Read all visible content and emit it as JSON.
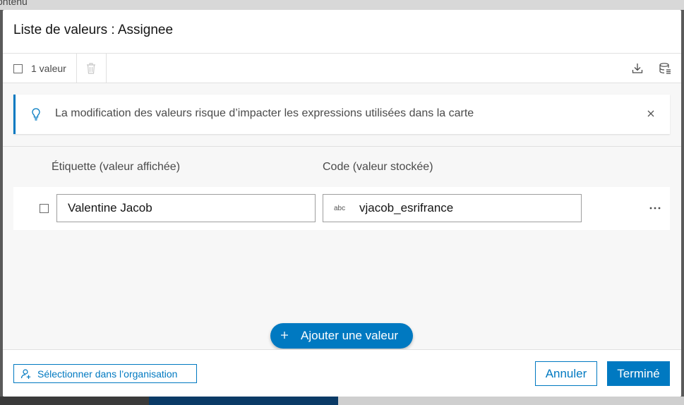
{
  "background": {
    "top_text": "ontenu"
  },
  "dialog": {
    "title": "Liste de valeurs : Assignee"
  },
  "toolbar": {
    "count_label": "1 valeur",
    "icons": [
      "trash-icon",
      "download-icon",
      "database-icon"
    ]
  },
  "notice": {
    "text": "La modification des valeurs risque d’impacter les expressions utilisées dans la carte",
    "icon": "lightbulb-icon"
  },
  "columns": {
    "label": "Étiquette (valeur affichée)",
    "code": "Code (valeur stockée)"
  },
  "rows": [
    {
      "label": "Valentine Jacob",
      "type": "abc",
      "code": "vjacob_esrifrance"
    }
  ],
  "actions": {
    "add_value": "Ajouter une valeur",
    "select_org": "Sélectionner dans l’organisation",
    "cancel": "Annuler",
    "done": "Terminé"
  },
  "colors": {
    "accent": "#0079c1",
    "content_bg": "#f7f7f7",
    "overlay": "#5a5a5a"
  }
}
